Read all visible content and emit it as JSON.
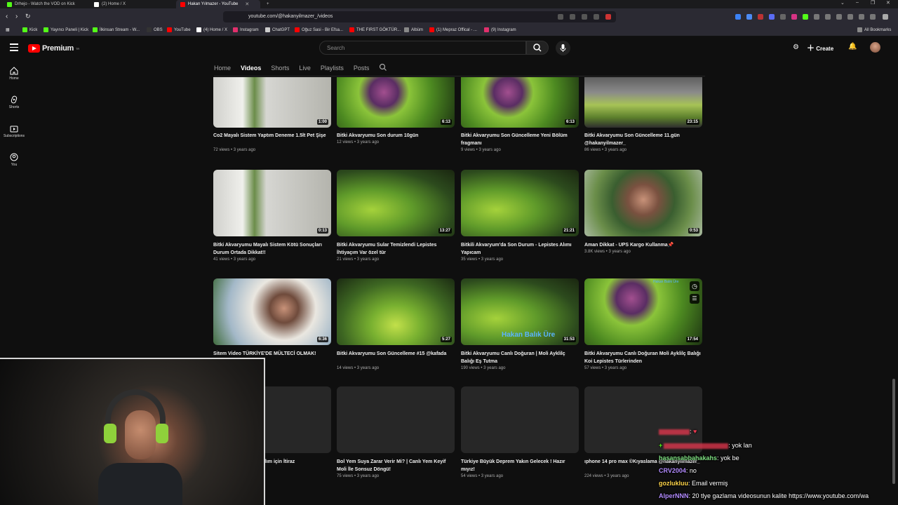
{
  "browser": {
    "tabs": [
      {
        "label": "Drhejo - Watch the VOD on Kick",
        "icon_color": "#53fc18"
      },
      {
        "label": "(2) Home / X",
        "icon_color": "#ffffff"
      },
      {
        "label": "Hakan Yılmazer - YouTube",
        "icon_color": "#ff0000"
      }
    ],
    "url": "youtube.com/@hakanyilmazer_/videos",
    "bookmarks": [
      {
        "label": "Kick",
        "color": "#53fc18"
      },
      {
        "label": "Yayıncı Paneli | Kick",
        "color": "#53fc18"
      },
      {
        "label": "İlkinsan Stream - W...",
        "color": "#53fc18"
      },
      {
        "label": "OBS",
        "color": "#333333"
      },
      {
        "label": "YouTube",
        "color": "#ff0000"
      },
      {
        "label": "(4) Home / X",
        "color": "#ffffff"
      },
      {
        "label": "Instagram",
        "color": "#e1306c"
      },
      {
        "label": "ChatGPT",
        "color": "#cccccc"
      },
      {
        "label": "Oğuz Sasi - Bir Efsa...",
        "color": "#ff0000"
      },
      {
        "label": "THE FIRST GÖKTÜR...",
        "color": "#ff0000"
      },
      {
        "label": "Albüm",
        "color": "#888888"
      },
      {
        "label": "(1) Mepraz Offical - ...",
        "color": "#ff0000"
      },
      {
        "label": "(9) Instagram",
        "color": "#e1306c"
      }
    ],
    "all_bookmarks": "All Bookmarks"
  },
  "header": {
    "logo_text": "Premium",
    "logo_sup": "TR",
    "search_placeholder": "Search",
    "create_label": "Create"
  },
  "guide": [
    {
      "label": "Home"
    },
    {
      "label": "Shorts"
    },
    {
      "label": "Subscriptions"
    },
    {
      "label": "You"
    }
  ],
  "channel_tabs": [
    "Home",
    "Videos",
    "Shorts",
    "Live",
    "Playlists",
    "Posts"
  ],
  "active_tab": "Videos",
  "videos": [
    {
      "title": "Co2 Mayalı Sistem Yaptım Deneme 1.5lt Pet Şişe",
      "views": "72 views",
      "age": "3 years ago",
      "duration": "1:00",
      "thumb": "hoses"
    },
    {
      "title": "Bitki Akvaryumu Son durum 10gün",
      "views": "12 views",
      "age": "3 years ago",
      "duration": "6:13",
      "thumb": "leafpink"
    },
    {
      "title": "Bitki Akvaryumu Son Güncelleme Yeni Bölüm fragmanı",
      "views": "9 views",
      "age": "3 years ago",
      "duration": "6:13",
      "thumb": "leafpink"
    },
    {
      "title": "Bitki Akvaryumu Son Güncelleme 11.gün @hakanyilmazer_",
      "views": "86 views",
      "age": "3 years ago",
      "duration": "23:15",
      "thumb": "tank"
    },
    {
      "title": "Bitki Akvaryumu Mayalı Sistem Kötü Sonuçları Durum Ortada Dikkat!!",
      "views": "41 views",
      "age": "3 years ago",
      "duration": "0:13",
      "thumb": "hoses"
    },
    {
      "title": "Bitki Akvaryumu Sular Temizlendi Lepistes İhtiyaçım Var özel tür",
      "views": "21 views",
      "age": "3 years ago",
      "duration": "13:27",
      "thumb": "plant"
    },
    {
      "title": "Bitkili Akvaryum'da Son Durum - Lepistes Alımı Yapıcam",
      "views": "35 views",
      "age": "3 years ago",
      "duration": "21:21",
      "thumb": "plant"
    },
    {
      "title": "Aman Dikkat - UPS Kargo Kullanma📌",
      "views": "3.8K views",
      "age": "3 years ago",
      "duration": "0:53",
      "thumb": "person"
    },
    {
      "title": "Sitem Video TÜRKİYE'DE MÜLTECİ OLMAK!",
      "views": "",
      "age": "",
      "duration": "6:36",
      "thumb": "person2"
    },
    {
      "title": "Bitki Akvaryumu Son Güncelleme #15 @kafada",
      "views": "14 views",
      "age": "3 years ago",
      "duration": "5:27",
      "thumb": "plant2"
    },
    {
      "title": "Bitki Akvaryumu Canlı Doğuran | Moli Ayklilç Balığı Eş Tutma",
      "views": "190 views",
      "age": "3 years ago",
      "duration": "31:53",
      "thumb": "plant",
      "overlay": "Hakan Balık Üre"
    },
    {
      "title": "Bitki Akvaryumu Canlı Doğuran Moli Ayklilç Balığı Koi Lepistes Türlerinden",
      "views": "57 views",
      "age": "3 years ago",
      "duration": "17:54",
      "thumb": "leafpink",
      "overlay_small": "Hakan Balık Üre"
    },
    {
      "title": "alım için İtiraz",
      "views": "",
      "age": "",
      "duration": "",
      "thumb": "placeholder"
    },
    {
      "title": "Bol Yem Suya Zarar Verir Mi? | Canlı Yem Keyif Moli İle Sonsuz Döngü!",
      "views": "75 views",
      "age": "3 years ago",
      "duration": "",
      "thumb": "placeholder"
    },
    {
      "title": "Türkiye Büyük Deprem Yakın Gelecek ! Hazır mıyız!",
      "views": "54 views",
      "age": "3 years ago",
      "duration": "",
      "thumb": "placeholder"
    },
    {
      "title": "ıphone 14 pro max ©Kıyaslama @hakanyilmazer_",
      "views": "224 views",
      "age": "3 years ago",
      "duration": "",
      "thumb": "placeholder"
    }
  ],
  "chat": [
    {
      "user": "",
      "user_color": "#e8384f",
      "message": ""
    },
    {
      "user": "",
      "user_color": "#e8384f",
      "message": "yok lan",
      "badge": "+"
    },
    {
      "user": "hasansabbahakahs",
      "user_color": "#7ee081",
      "message": "yok be"
    },
    {
      "user": "CRV2004",
      "user_color": "#b38cff",
      "message": "no"
    },
    {
      "user": "gozlukluu",
      "user_color": "#ffd54a",
      "message": "Email vermiş"
    },
    {
      "user": "AlperNNN",
      "user_color": "#b38cff",
      "message": "20 tlye gazlama videosunun kalite https://www.youtube.com/wa"
    }
  ]
}
